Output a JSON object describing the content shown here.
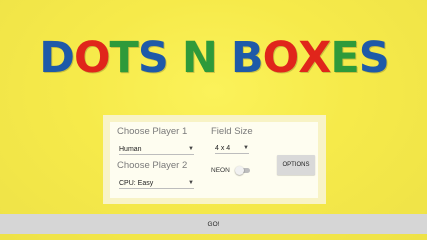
{
  "title": {
    "letters": [
      {
        "char": "D",
        "color": "#1e5aa8"
      },
      {
        "char": "O",
        "color": "#e0251b"
      },
      {
        "char": "T",
        "color": "#2e9a3a"
      },
      {
        "char": "S",
        "color": "#1e5aa8"
      },
      {
        "char": "N",
        "color": "#2e9a3a"
      },
      {
        "char": "B",
        "color": "#1e5aa8"
      },
      {
        "char": "O",
        "color": "#e0251b"
      },
      {
        "char": "X",
        "color": "#e0251b"
      },
      {
        "char": "E",
        "color": "#2e9a3a"
      },
      {
        "char": "S",
        "color": "#1e5aa8"
      }
    ]
  },
  "player1": {
    "label": "Choose Player 1",
    "value": "Human"
  },
  "player2": {
    "label": "Choose Player 2",
    "value": "CPU: Easy"
  },
  "field_size": {
    "label": "Field Size",
    "value": "4 x 4"
  },
  "neon": {
    "label": "NEON",
    "enabled": false
  },
  "options_button": "OPTIONS",
  "go_button": "GO!",
  "icons": {
    "dropdown": "caret-down-icon",
    "toggle": "toggle-switch"
  },
  "colors": {
    "background": "#f6ea4a",
    "panel": "#f8f3c6",
    "button": "#d9d9d9"
  }
}
